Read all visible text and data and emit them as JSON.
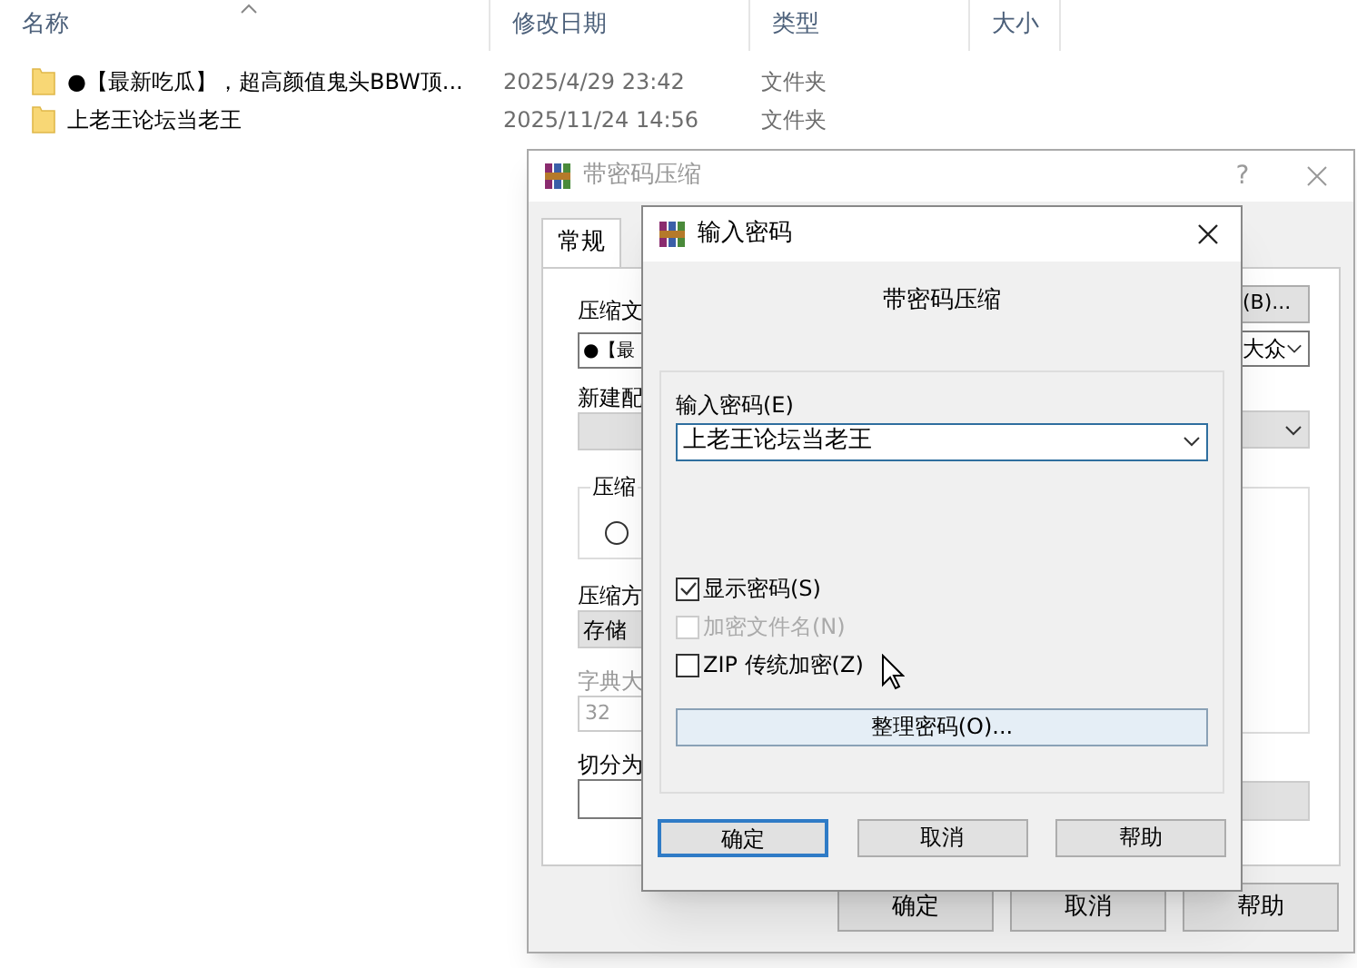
{
  "explorer": {
    "columns": [
      {
        "label": "名称",
        "sorted": true
      },
      {
        "label": "修改日期",
        "sorted": false
      },
      {
        "label": "类型",
        "sorted": false
      },
      {
        "label": "大小",
        "sorted": false
      }
    ],
    "rows": [
      {
        "name": "●【最新吃瓜】，超高颜值鬼头BBW顶...",
        "date": "2025/4/29 23:42",
        "type": "文件夹"
      },
      {
        "name": "上老王论坛当老王",
        "date": "2025/11/24 14:56",
        "type": "文件夹"
      }
    ]
  },
  "back_dialog": {
    "title": "带密码压缩",
    "help": "?",
    "tabs": [
      {
        "label": "常规",
        "selected": true
      }
    ],
    "left": {
      "archive_label": "压缩文",
      "archive_value": "●【最",
      "profile_label": "新建配",
      "group_label": "压缩",
      "radio_selected": false,
      "method_label": "压缩方",
      "method_value": "存储",
      "dict_label": "字典大",
      "dict_value": "32",
      "split_label": "切分为"
    },
    "right": {
      "browse_button": "(B)...",
      "update_value": "大众"
    },
    "buttons": [
      "确定",
      "取消",
      "帮助"
    ]
  },
  "dialog": {
    "title": "输入密码",
    "heading": "带密码压缩",
    "password_label": "输入密码(E)",
    "password_value": "上老王论坛当老王",
    "checkboxes": [
      {
        "label": "显示密码(S)",
        "checked": true,
        "disabled": false
      },
      {
        "label": "加密文件名(N)",
        "checked": false,
        "disabled": true
      },
      {
        "label": "ZIP 传统加密(Z)",
        "checked": false,
        "disabled": false
      }
    ],
    "organize_button": "整理密码(O)...",
    "buttons": [
      {
        "label": "确定",
        "default": true
      },
      {
        "label": "取消",
        "default": false
      },
      {
        "label": "帮助",
        "default": false
      }
    ]
  }
}
